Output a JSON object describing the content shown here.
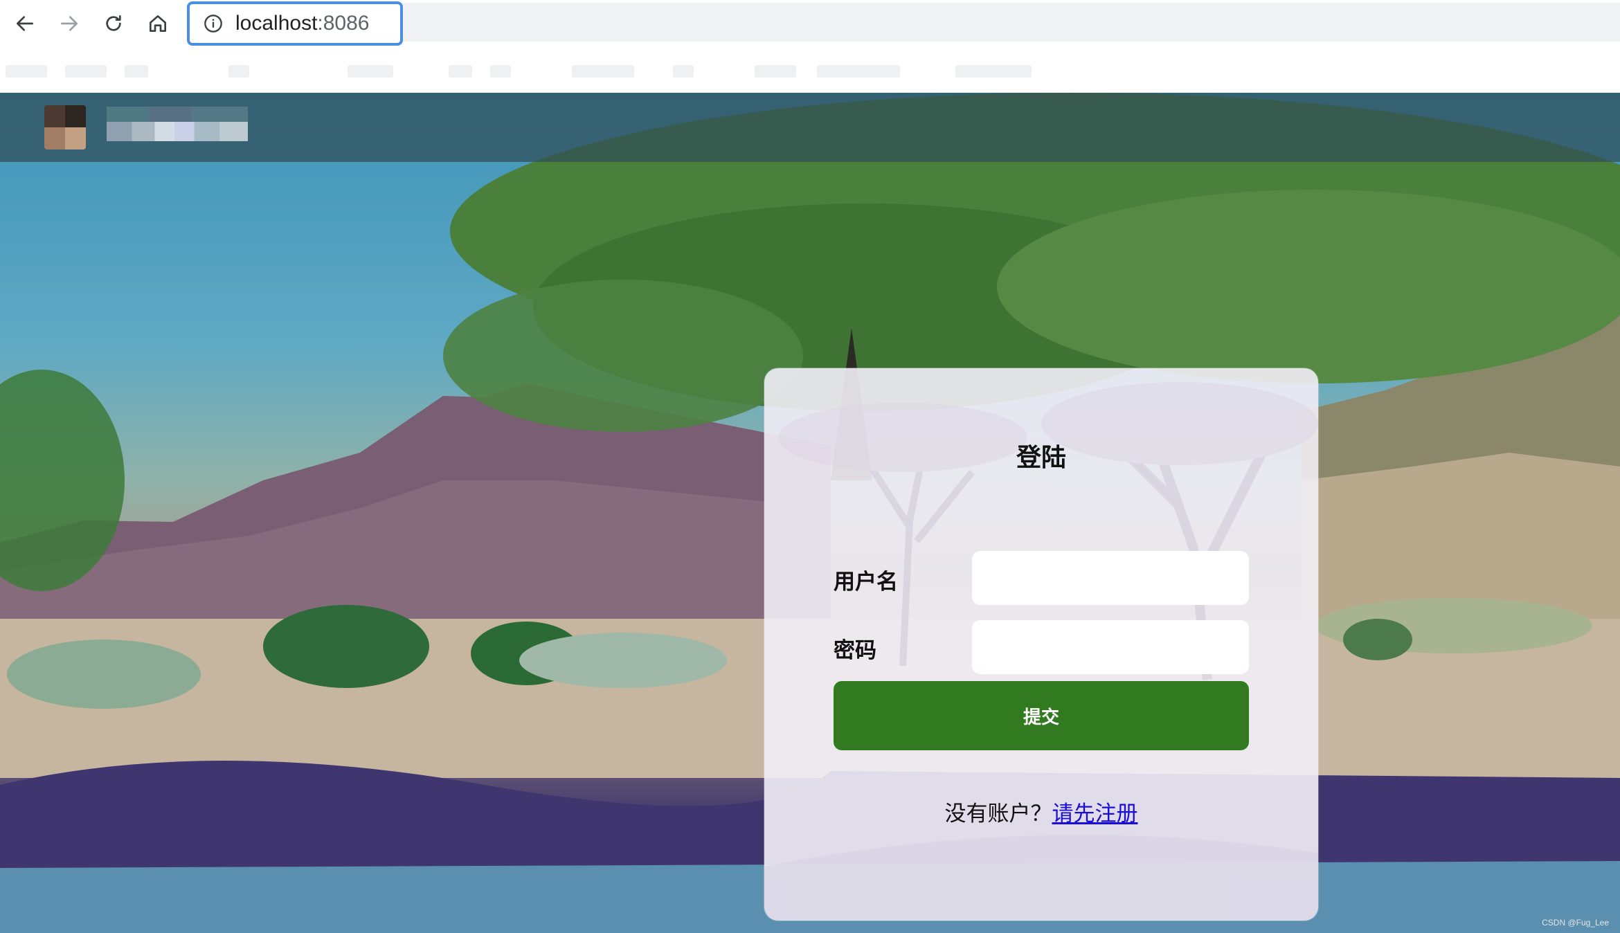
{
  "browser": {
    "url_host": "localhost",
    "url_port": ":8086"
  },
  "login": {
    "title": "登陆",
    "username_label": "用户名",
    "username_value": "",
    "password_label": "密码",
    "password_value": "",
    "submit_label": "提交",
    "register_prompt": "没有账户？",
    "register_link": "请先注册"
  },
  "colors": {
    "submit_button": "#317a1f",
    "link": "#1a0dd6",
    "url_focus_border": "#4a90e2"
  },
  "watermark": "CSDN @Fug_Lee"
}
